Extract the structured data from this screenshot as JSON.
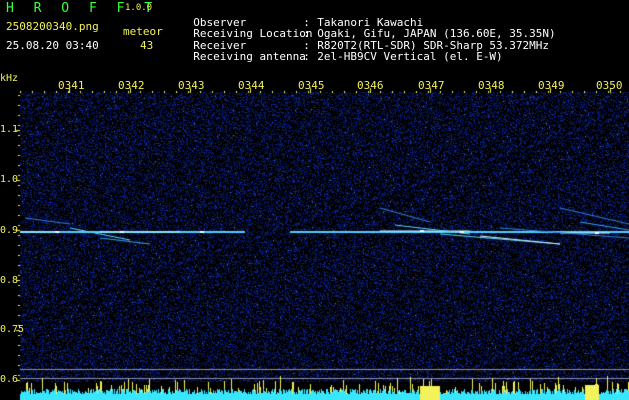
{
  "header": {
    "app_title": "H R O F F T",
    "app_version": "1.0.0",
    "filename": "2508200340.png",
    "datetime": "25.08.20 03:40",
    "meteor_label": "meteor",
    "meteor_count": "43"
  },
  "info": [
    {
      "key": "Observer",
      "sep": ":",
      "value": "Takanori Kawachi"
    },
    {
      "key": "Receiving Location",
      "sep": ":",
      "value": "Ogaki, Gifu, JAPAN (136.60E, 35.35N)"
    },
    {
      "key": "Receiver",
      "sep": ":",
      "value": "R820T2(RTL-SDR) SDR-Sharp 53.372MHz"
    },
    {
      "key": "Receiving antenna",
      "sep": ":",
      "value": "2el-HB9CV Vertical (el. E-W)"
    }
  ],
  "spectrogram": {
    "y_unit": "kHz",
    "y_ticks": [
      "1.1",
      "1.0",
      "0.9",
      "0.8",
      "0.75",
      "0.7",
      "0.6"
    ],
    "x_ticks": [
      "0341",
      "0342",
      "0343",
      "0344",
      "0345",
      "0346",
      "0347",
      "0348",
      "0349",
      "0350"
    ],
    "colors": {
      "text_green": "#3cff3c",
      "text_yellow": "#f2f25a",
      "noise": "#1a2a9a",
      "signal": "#5ad8ff",
      "trace": "#e8f0ff"
    }
  }
}
